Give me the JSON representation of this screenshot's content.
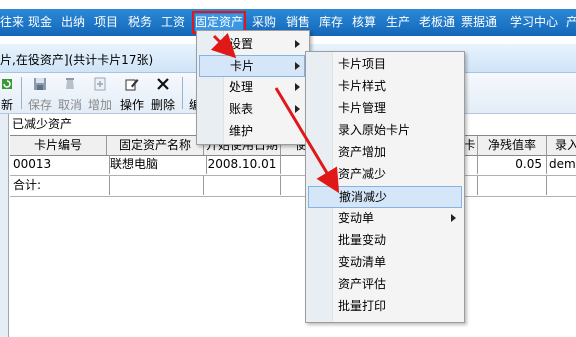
{
  "menubar": {
    "items": [
      "往来",
      "现金",
      "出纳",
      "项目",
      "税务",
      "工资",
      "固定资产",
      "采购",
      "销售",
      "库存",
      "核算",
      "生产",
      "老板通",
      "票据通",
      "学习中心",
      "产"
    ],
    "active_index": 6
  },
  "window": {
    "title": "片,在役资产](共计卡片17张)"
  },
  "toolbar": {
    "buttons": [
      {
        "label": "新",
        "icon": "refresh-icon",
        "enabled": true
      },
      {
        "label": "保存",
        "icon": "save-icon",
        "enabled": false
      },
      {
        "label": "取消",
        "icon": "undo-icon",
        "enabled": false
      },
      {
        "label": "增加",
        "icon": "add-icon",
        "enabled": false
      },
      {
        "label": "操作",
        "icon": "edit-icon",
        "enabled": true
      },
      {
        "label": "删除",
        "icon": "delete-icon",
        "enabled": true
      },
      {
        "label": "编",
        "icon": "",
        "enabled": true
      }
    ]
  },
  "content": {
    "section_label": "已减少资产",
    "table": {
      "headers": [
        "卡片编号",
        "固定资产名称",
        "开始使用日期",
        "使",
        "卡",
        "净残值率",
        "录入"
      ],
      "rows": [
        [
          "00013",
          "联想电脑",
          "2008.10.01",
          "5",
          "",
          "0.05",
          "demo"
        ],
        [
          "合计:",
          "",
          "",
          "",
          "",
          "",
          ""
        ]
      ]
    }
  },
  "menus": {
    "main": {
      "items": [
        {
          "label": "设置",
          "submenu": true
        },
        {
          "label": "卡片",
          "submenu": true,
          "highlighted": true
        },
        {
          "label": "处理",
          "submenu": true
        },
        {
          "label": "账表",
          "submenu": true
        },
        {
          "label": "维护",
          "submenu": false
        }
      ]
    },
    "card_submenu": {
      "items": [
        {
          "label": "卡片项目",
          "submenu": false
        },
        {
          "label": "卡片样式",
          "submenu": false
        },
        {
          "label": "卡片管理",
          "submenu": false
        },
        {
          "label": "录入原始卡片",
          "submenu": false
        },
        {
          "label": "资产增加",
          "submenu": false
        },
        {
          "label": "资产减少",
          "submenu": false
        },
        {
          "label": "撤消减少",
          "submenu": false,
          "highlighted": true
        },
        {
          "label": "变动单",
          "submenu": true
        },
        {
          "label": "批量变动",
          "submenu": false
        },
        {
          "label": "变动清单",
          "submenu": false
        },
        {
          "label": "资产评估",
          "submenu": false
        },
        {
          "label": "批量打印",
          "submenu": false
        }
      ]
    }
  },
  "colors": {
    "menubar": "#1a6fc2",
    "highlight": "#d5e6f8",
    "annotation": "#e01818"
  }
}
